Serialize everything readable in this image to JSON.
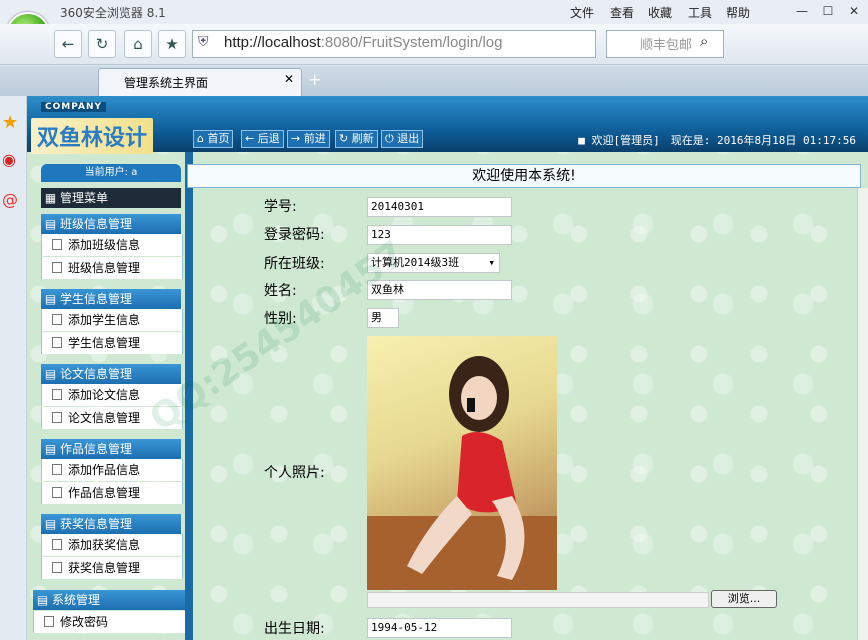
{
  "browser": {
    "title": "360安全浏览器 8.1",
    "menu": [
      "文件",
      "查看",
      "收藏",
      "工具",
      "帮助"
    ],
    "address_host": "http://localhost",
    "address_rest": ":8080/FruitSystem/login/log",
    "search_placeholder": "顺丰包邮",
    "tab_title": "管理系统主界面"
  },
  "header": {
    "company": "COMPANY",
    "brand": "双鱼林设计",
    "buttons": [
      "首页",
      "后退",
      "前进",
      "刷新",
      "退出"
    ],
    "welcome": "欢迎[管理员]",
    "datetime": "现在是: 2016年8月18日 01:17:56"
  },
  "sidebar": {
    "current_user": "当前用户: a",
    "menu_title": "管理菜单",
    "groups": [
      {
        "title": "班级信息管理",
        "items": [
          "添加班级信息",
          "班级信息管理"
        ]
      },
      {
        "title": "学生信息管理",
        "items": [
          "添加学生信息",
          "学生信息管理"
        ]
      },
      {
        "title": "论文信息管理",
        "items": [
          "添加论文信息",
          "论文信息管理"
        ]
      },
      {
        "title": "作品信息管理",
        "items": [
          "添加作品信息",
          "作品信息管理"
        ]
      },
      {
        "title": "获奖信息管理",
        "items": [
          "添加获奖信息",
          "获奖信息管理"
        ]
      },
      {
        "title": "系统管理",
        "items": [
          "修改密码"
        ]
      }
    ]
  },
  "content": {
    "banner": "欢迎使用本系统!",
    "fields": {
      "student_no_label": "学号:",
      "student_no": "20140301",
      "password_label": "登录密码:",
      "password": "123",
      "class_label": "所在班级:",
      "class": "计算机2014级3班",
      "name_label": "姓名:",
      "name": "双鱼林",
      "gender_label": "性别:",
      "gender": "男",
      "photo_label": "个人照片:",
      "browse": "浏览...",
      "birth_label": "出生日期:",
      "birth": "1994-05-12"
    },
    "watermark": "QQ:254540457"
  }
}
